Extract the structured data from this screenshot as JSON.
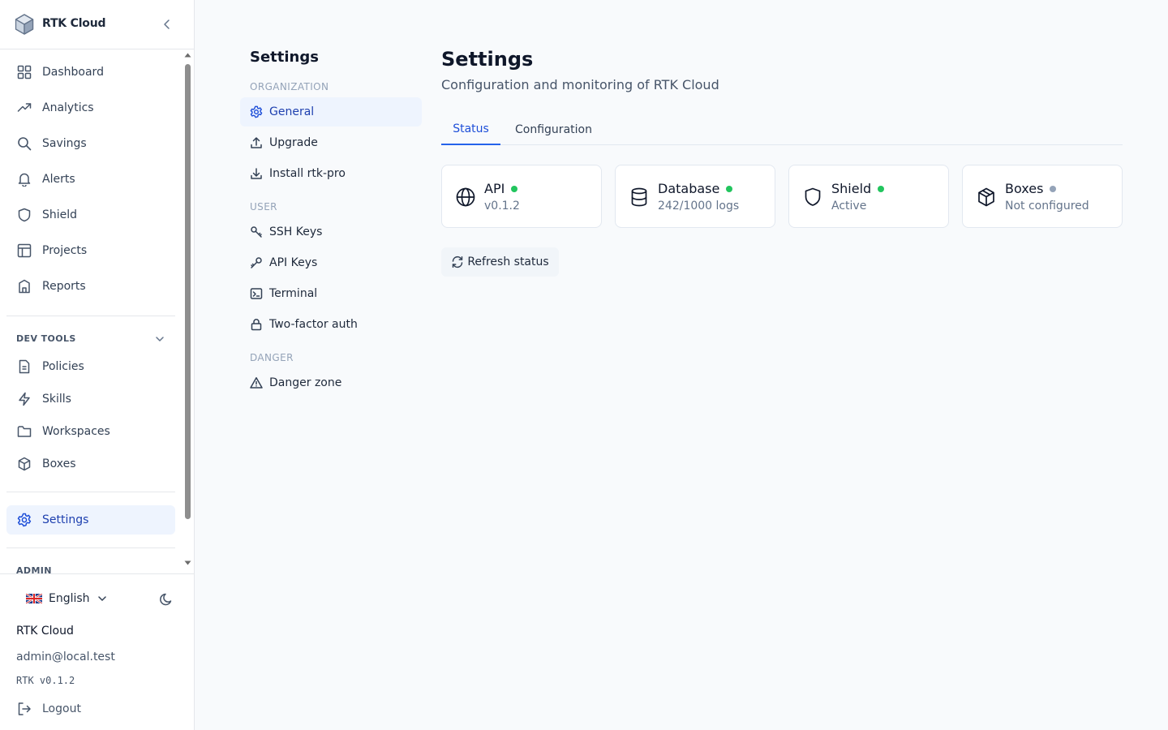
{
  "brand": {
    "name": "RTK Cloud"
  },
  "sidebar": {
    "items": [
      {
        "label": "Dashboard",
        "icon": "dashboard-icon"
      },
      {
        "label": "Analytics",
        "icon": "trending-up-icon"
      },
      {
        "label": "Savings",
        "icon": "search-icon"
      },
      {
        "label": "Alerts",
        "icon": "bell-icon"
      },
      {
        "label": "Shield",
        "icon": "shield-icon"
      },
      {
        "label": "Projects",
        "icon": "table-icon"
      },
      {
        "label": "Reports",
        "icon": "building-icon"
      }
    ],
    "dev_tools": {
      "heading": "DEV TOOLS",
      "items": [
        {
          "label": "Policies",
          "icon": "file-icon"
        },
        {
          "label": "Skills",
          "icon": "lightning-icon"
        },
        {
          "label": "Workspaces",
          "icon": "folder-icon"
        },
        {
          "label": "Boxes",
          "icon": "box-icon"
        }
      ]
    },
    "settings_item": {
      "label": "Settings",
      "icon": "gear-icon",
      "active": true
    },
    "admin_heading": "ADMIN"
  },
  "footer": {
    "language": "English",
    "app_name": "RTK Cloud",
    "email": "admin@local.test",
    "version": "RTK v0.1.2",
    "logout": "Logout"
  },
  "subnav": {
    "title": "Settings",
    "organization_heading": "ORGANIZATION",
    "organization": [
      {
        "label": "General",
        "icon": "gear-icon",
        "active": true
      },
      {
        "label": "Upgrade",
        "icon": "upload-icon"
      },
      {
        "label": "Install rtk-pro",
        "icon": "download-icon"
      }
    ],
    "user_heading": "USER",
    "user": [
      {
        "label": "SSH Keys",
        "icon": "key-icon"
      },
      {
        "label": "API Keys",
        "icon": "key-icon"
      },
      {
        "label": "Terminal",
        "icon": "terminal-icon"
      },
      {
        "label": "Two-factor auth",
        "icon": "lock-icon"
      }
    ],
    "danger_heading": "DANGER",
    "danger": [
      {
        "label": "Danger zone",
        "icon": "warning-icon"
      }
    ]
  },
  "main": {
    "title": "Settings",
    "subtitle": "Configuration and monitoring of RTK Cloud",
    "tabs": [
      {
        "label": "Status",
        "active": true
      },
      {
        "label": "Configuration",
        "active": false
      }
    ],
    "cards": [
      {
        "name": "API",
        "value": "v0.1.2",
        "icon": "globe-icon",
        "status_color": "#22c55e"
      },
      {
        "name": "Database",
        "value": "242/1000 logs",
        "icon": "database-icon",
        "status_color": "#22c55e"
      },
      {
        "name": "Shield",
        "value": "Active",
        "icon": "shield-icon",
        "status_color": "#22c55e"
      },
      {
        "name": "Boxes",
        "value": "Not configured",
        "icon": "box-icon",
        "status_color": "#94a3b8"
      }
    ],
    "refresh_label": "Refresh status"
  },
  "colors": {
    "accent": "#2563eb",
    "active_bg": "#eef4fe",
    "status_ok": "#22c55e",
    "status_off": "#94a3b8"
  }
}
